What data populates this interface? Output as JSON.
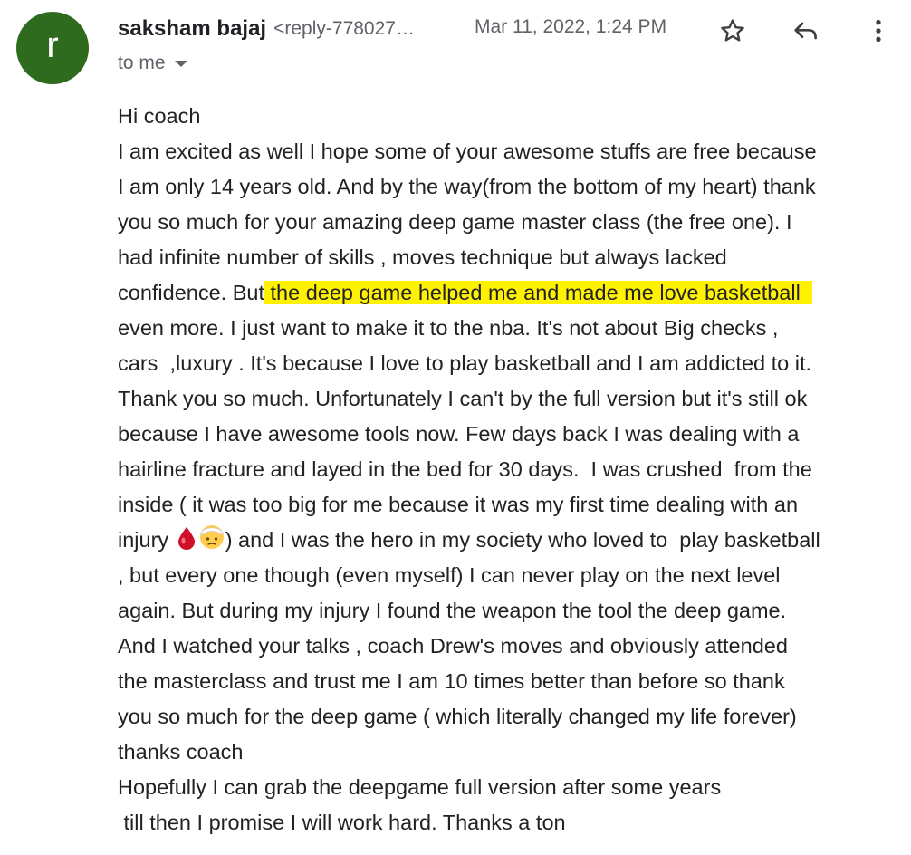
{
  "header": {
    "avatar_letter": "r",
    "sender_name": "saksham bajaj",
    "sender_email": "<reply-778027…",
    "date": "Mar 11, 2022, 1:24 PM",
    "to_label": "to me",
    "star_icon": "star-icon",
    "reply_icon": "reply-icon",
    "more_icon": "more-vert-icon"
  },
  "colors": {
    "avatar_bg": "#2e6b1f",
    "highlight": "#fff200"
  },
  "message": {
    "greeting": "Hi coach",
    "lines": [
      "I am excited as well I hope some of your awesome stuffs are free because",
      "I am only 14 years old. And by the way(from the bottom of my heart) thank",
      "you so much for your amazing deep game master class (the free one). I",
      "had infinite number of skills , moves technique but always lacked"
    ],
    "line5_pre": "confidence. But",
    "line5_highlight": " the deep game helped me and made me love basketball  ",
    "lines_b": [
      "even more. I just want to make it to the nba. It's not about Big checks ,",
      "cars  ,luxury . It's because I love to play basketball and I am addicted to it.",
      "Thank you so much. Unfortunately I can't by the full version but it's still ok",
      "because I have awesome tools now. Few days back I was dealing with a",
      "hairline fracture and layed in the bed for 30 days.  I was crushed  from the",
      "inside ( it was too big for me because it was my first time dealing with an"
    ],
    "line12_pre": "injury ",
    "line12_post": ") and I was the hero in my society who loved to  play basketball",
    "lines_c": [
      ", but every one though (even myself) I can never play on the next level",
      "again. But during my injury I found the weapon the tool the deep game.",
      "And I watched your talks , coach Drew's moves and obviously attended",
      "the masterclass and trust me I am 10 times better than before so thank",
      "you so much for the deep game ( which literally changed my life forever)",
      "thanks coach",
      "Hopefully I can grab the deepgame full version after some years",
      " till then I promise I will work hard. Thanks a ton"
    ],
    "emoji_1": "drop-of-blood-emoji",
    "emoji_2": "bandaged-face-emoji"
  }
}
